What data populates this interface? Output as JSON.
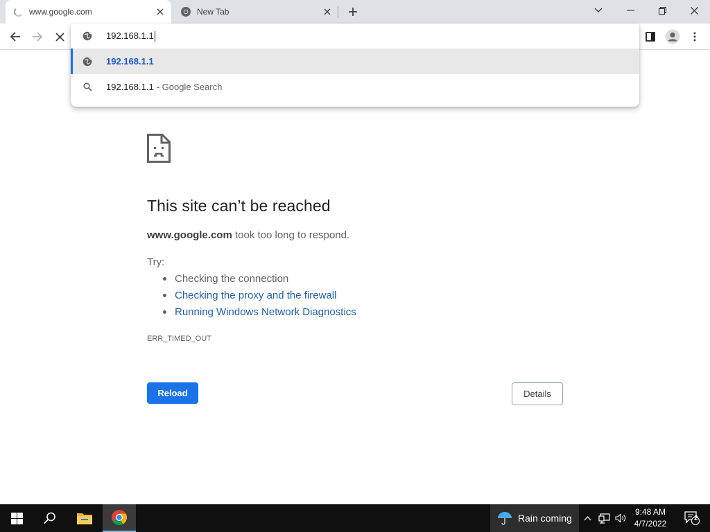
{
  "tabs": [
    {
      "title": "www.google.com",
      "active": true,
      "loading": true
    },
    {
      "title": "New Tab",
      "active": false,
      "loading": false
    }
  ],
  "omnibox": {
    "typed_text": "192.168.1.1",
    "suggestions": [
      {
        "primary": "192.168.1.1",
        "secondary": "",
        "icon": "globe-icon",
        "selected": true
      },
      {
        "primary": "192.168.1.1",
        "secondary": "- Google Search",
        "icon": "search-icon",
        "selected": false
      }
    ]
  },
  "error_page": {
    "heading": "This site can’t be reached",
    "host": "www.google.com",
    "summary_rest": "took too long to respond.",
    "try_label": "Try:",
    "suggestions": [
      {
        "text": "Checking the connection",
        "link": false
      },
      {
        "text": "Checking the proxy and the firewall",
        "link": true
      },
      {
        "text": "Running Windows Network Diagnostics",
        "link": true
      }
    ],
    "error_code": "ERR_TIMED_OUT",
    "reload_label": "Reload",
    "details_label": "Details"
  },
  "taskbar": {
    "weather_text": "Rain coming",
    "time": "9:48 AM",
    "date": "4/7/2022",
    "notification_count": "2"
  },
  "colors": {
    "accent": "#1a73e8",
    "link": "#1f5fa8",
    "tabstrip_bg": "#dee1e6",
    "taskbar_bg": "#101010"
  }
}
